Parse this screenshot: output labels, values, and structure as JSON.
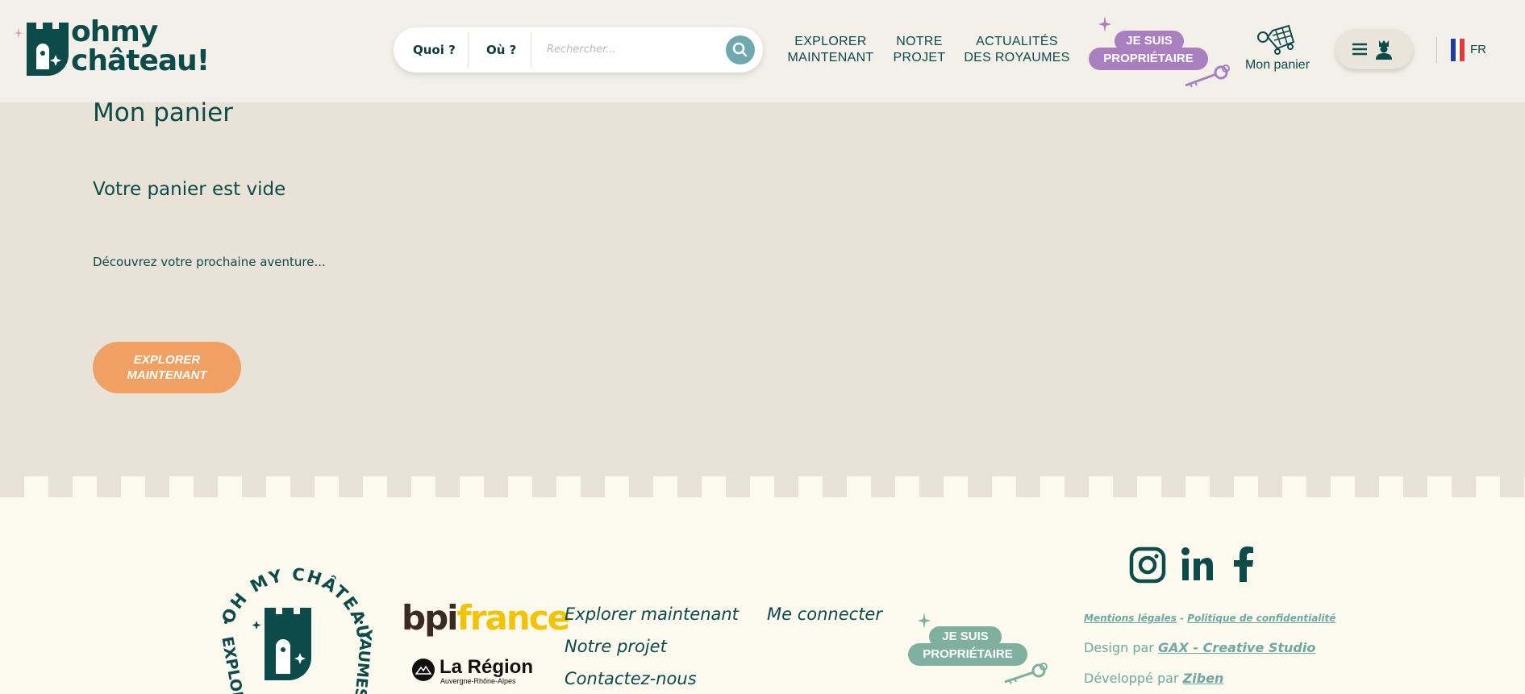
{
  "header": {
    "logo_line1": "ohmy",
    "logo_line2": "château!",
    "search": {
      "what_label": "Quoi ?",
      "where_label": "Où ?",
      "placeholder": "Rechercher..."
    },
    "nav": [
      {
        "line1": "EXPLORER",
        "line2": "MAINTENANT"
      },
      {
        "line1": "NOTRE",
        "line2": "PROJET"
      },
      {
        "line1": "ACTUALITÉS",
        "line2": "DES ROYAUMES"
      }
    ],
    "owner_badge": {
      "line1": "JE SUIS",
      "line2": "PROPRIÉTAIRE"
    },
    "cart_label": "Mon panier",
    "language": "FR"
  },
  "main": {
    "title": "Mon panier",
    "empty_message": "Votre panier est vide",
    "discover_text": "Découvrez votre prochaine aventure...",
    "cta": {
      "line1": "EXPLORER",
      "line2": "MAINTENANT"
    }
  },
  "footer": {
    "seal_text_top": "OH MY CHÂTEAU !",
    "seal_text_left": "EXPLOR",
    "seal_text_right": "YAUMES",
    "bpi_part1": "bpi",
    "bpi_part2": "france",
    "region_name": "La Région",
    "region_sub": "Auvergne-Rhône-Alpes",
    "links_col1": [
      "Explorer maintenant",
      "Notre projet",
      "Contactez-nous"
    ],
    "links_col2": [
      "Me connecter"
    ],
    "owner_badge": {
      "line1": "JE SUIS",
      "line2": "PROPRIÉTAIRE"
    },
    "social": [
      "instagram-icon",
      "linkedin-icon",
      "facebook-icon"
    ],
    "legal": {
      "mentions": "Mentions légales",
      "separator": "-",
      "privacy": "Politique de confidentialité"
    },
    "design": {
      "prefix": "Design par",
      "name": "GAX - Creative Studio"
    },
    "dev": {
      "prefix": "Développé par",
      "name": "Ziben"
    }
  },
  "colors": {
    "primary": "#0d4a4a",
    "page_bg": "#e8e3d6",
    "header_bg": "#f3f0ea",
    "footer_bg": "#fcf9ef",
    "purple": "#a97fc0",
    "orange": "#f0a063",
    "teal": "#6fa8ad",
    "sage": "#7faf9f"
  }
}
